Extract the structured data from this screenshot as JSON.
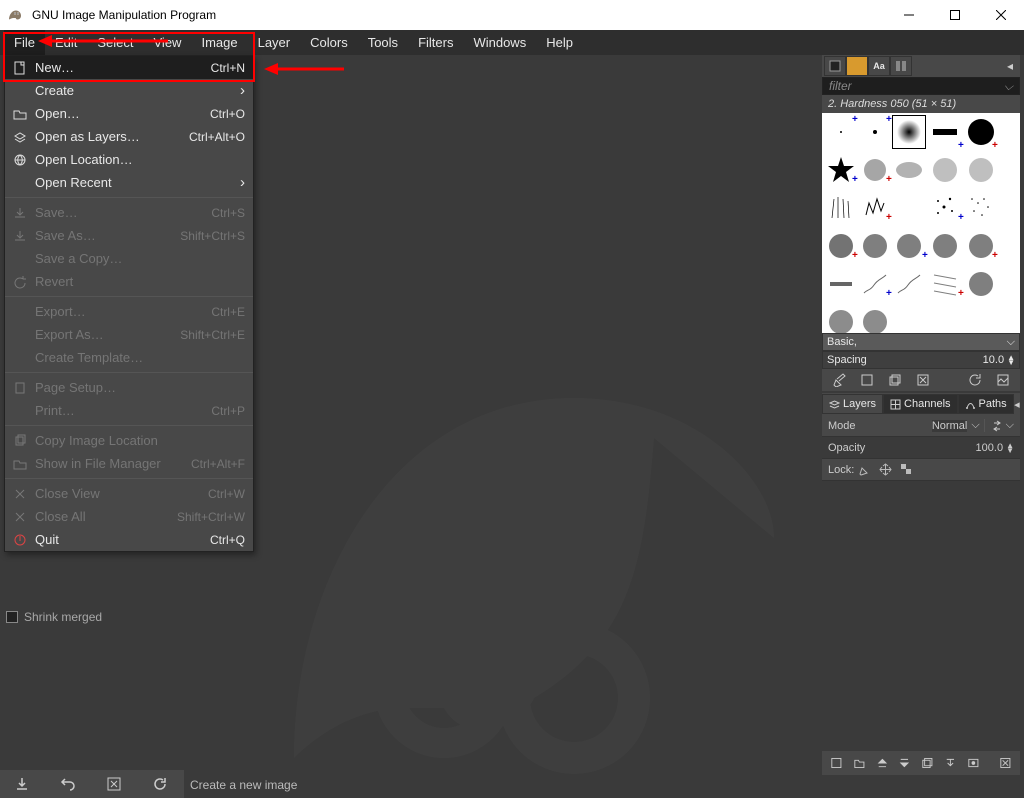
{
  "window": {
    "title": "GNU Image Manipulation Program"
  },
  "menubar": [
    "File",
    "Edit",
    "Select",
    "View",
    "Image",
    "Layer",
    "Colors",
    "Tools",
    "Filters",
    "Windows",
    "Help"
  ],
  "file_menu": {
    "new": {
      "label": "New…",
      "shortcut": "Ctrl+N"
    },
    "create": {
      "label": "Create"
    },
    "open": {
      "label": "Open…",
      "shortcut": "Ctrl+O"
    },
    "open_layers": {
      "label": "Open as Layers…",
      "shortcut": "Ctrl+Alt+O"
    },
    "open_loc": {
      "label": "Open Location…"
    },
    "open_recent": {
      "label": "Open Recent"
    },
    "save": {
      "label": "Save…",
      "shortcut": "Ctrl+S"
    },
    "save_as": {
      "label": "Save As…",
      "shortcut": "Shift+Ctrl+S"
    },
    "save_copy": {
      "label": "Save a Copy…"
    },
    "revert": {
      "label": "Revert"
    },
    "export": {
      "label": "Export…",
      "shortcut": "Ctrl+E"
    },
    "export_as": {
      "label": "Export As…",
      "shortcut": "Shift+Ctrl+E"
    },
    "create_tmpl": {
      "label": "Create Template…"
    },
    "page_setup": {
      "label": "Page Setup…"
    },
    "print": {
      "label": "Print…",
      "shortcut": "Ctrl+P"
    },
    "copy_loc": {
      "label": "Copy Image Location"
    },
    "show_fm": {
      "label": "Show in File Manager",
      "shortcut": "Ctrl+Alt+F"
    },
    "close_view": {
      "label": "Close View",
      "shortcut": "Ctrl+W"
    },
    "close_all": {
      "label": "Close All",
      "shortcut": "Shift+Ctrl+W"
    },
    "quit": {
      "label": "Quit",
      "shortcut": "Ctrl+Q"
    }
  },
  "shrink_merged_label": "Shrink merged",
  "statusbar": "Create a new image",
  "brushes": {
    "filter_placeholder": "filter",
    "current": "2. Hardness 050 (51 × 51)",
    "preset": "Basic,",
    "spacing_label": "Spacing",
    "spacing_value": "10.0"
  },
  "layers_panel": {
    "tabs": [
      "Layers",
      "Channels",
      "Paths"
    ],
    "mode_label": "Mode",
    "mode_value": "Normal",
    "opacity_label": "Opacity",
    "opacity_value": "100.0",
    "lock_label": "Lock:"
  }
}
